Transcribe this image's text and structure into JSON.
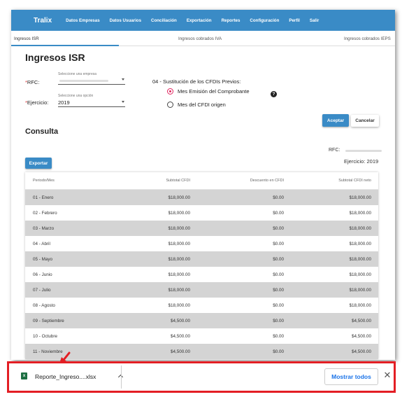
{
  "nav": {
    "brand": "Tralix",
    "items": [
      "Datos Empresas",
      "Datos Usuarios",
      "Conciliación",
      "Exportación",
      "Reportes",
      "Configuración",
      "Perfil",
      "Salir"
    ]
  },
  "tabs": [
    "Ingresos ISR",
    "Ingresos cobrados IVA",
    "Ingresos cobrados IEPS"
  ],
  "page_title": "Ingresos ISR",
  "form": {
    "rfc_label": "RFC:",
    "rfc_hint": "Seleccione una empresa",
    "ejercicio_label": "Ejercicio:",
    "ejercicio_hint": "Seleccione una opción",
    "ejercicio_value": "2019",
    "sustitucion_label": "04 - Sustitución de los CFDIs Previos:",
    "radio_options": [
      "Mes Emisión del Comprobante",
      "Mes del CFDI origen"
    ],
    "radio_selected": 0,
    "accept": "Aceptar",
    "cancel": "Cancelar"
  },
  "consulta": {
    "title": "Consulta",
    "export": "Exportar",
    "rfc_label": "RFC:",
    "ejercicio_text": "Ejercicio: 2019"
  },
  "table": {
    "headers": [
      "Periodo/Mes",
      "Subtotal CFDI",
      "Descuento en CFDI",
      "Subtotal CFDI neto"
    ],
    "rows": [
      [
        "01 - Enero",
        "$18,000.00",
        "$0.00",
        "$18,000.00"
      ],
      [
        "02 - Febrero",
        "$18,000.00",
        "$0.00",
        "$18,000.00"
      ],
      [
        "03 - Marzo",
        "$18,000.00",
        "$0.00",
        "$18,000.00"
      ],
      [
        "04 - Abril",
        "$18,000.00",
        "$0.00",
        "$18,000.00"
      ],
      [
        "05 - Mayo",
        "$18,000.00",
        "$0.00",
        "$18,000.00"
      ],
      [
        "06 - Junio",
        "$18,000.00",
        "$0.00",
        "$18,000.00"
      ],
      [
        "07 - Julio",
        "$18,000.00",
        "$0.00",
        "$18,000.00"
      ],
      [
        "08 - Agosto",
        "$18,000.00",
        "$0.00",
        "$18,000.00"
      ],
      [
        "09 - Septiembre",
        "$4,500.00",
        "$0.00",
        "$4,500.00"
      ],
      [
        "10 - Octubre",
        "$4,500.00",
        "$0.00",
        "$4,500.00"
      ],
      [
        "11 - Noviembre",
        "$4,500.00",
        "$0.00",
        "$4,500.00"
      ]
    ]
  },
  "download": {
    "file_name": "Reporte_Ingreso....xlsx",
    "show_all": "Mostrar todos",
    "file_icon": "excel-file-icon",
    "close_icon": "close-icon",
    "chevron_icon": "chevron-up-icon"
  },
  "colors": {
    "primary": "#3a8bc6",
    "highlight_border": "#e31e24",
    "radio_accent": "#e0245e",
    "link_blue": "#1a73e8"
  }
}
